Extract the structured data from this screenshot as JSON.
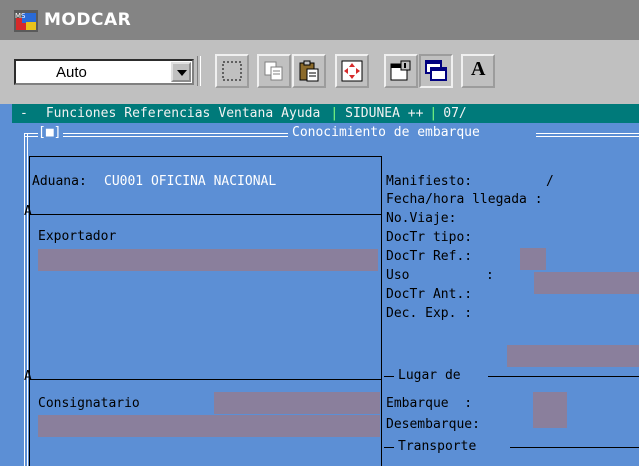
{
  "window": {
    "title": "MODCAR"
  },
  "toolbar": {
    "combo_value": "Auto",
    "font_button_label": "A"
  },
  "menu": {
    "dash": "-",
    "items": [
      "Funciones",
      "Referencias",
      "Ventana",
      "Ayuda"
    ],
    "system": "SIDUNEA ++",
    "date_fragment": "07/"
  },
  "form": {
    "marker": "[■]",
    "title": "Conocimiento de embarque",
    "aduana_label": "Aduana:",
    "aduana_value": "CU001 OFICINA NACIONAL",
    "exportador_label": "Exportador",
    "consignatario_label": "Consignatario",
    "manifiesto_label": "Manifiesto:",
    "manifiesto_value": "/",
    "fecha_label": "Fecha/hora llegada :",
    "noviaje_label": "No.Viaje:",
    "doctr_tipo_label": "DocTr tipo:",
    "doctr_ref_label": "DocTr Ref.:",
    "uso_label": "Uso",
    "uso_colon": ":",
    "doctr_ant_label": "DocTr Ant.:",
    "dec_exp_label": "Dec. Exp. :",
    "lugar_label": "Lugar de",
    "embarque_label": "Embarque  :",
    "desembarque_label": "Desembarque:",
    "transporte_label": "Transporte",
    "corner_a1": "A",
    "corner_a2": "A"
  },
  "colors": {
    "terminal_bg": "#5c8fd5",
    "field": "#8a7f9c",
    "menubar": "#007a7a"
  }
}
